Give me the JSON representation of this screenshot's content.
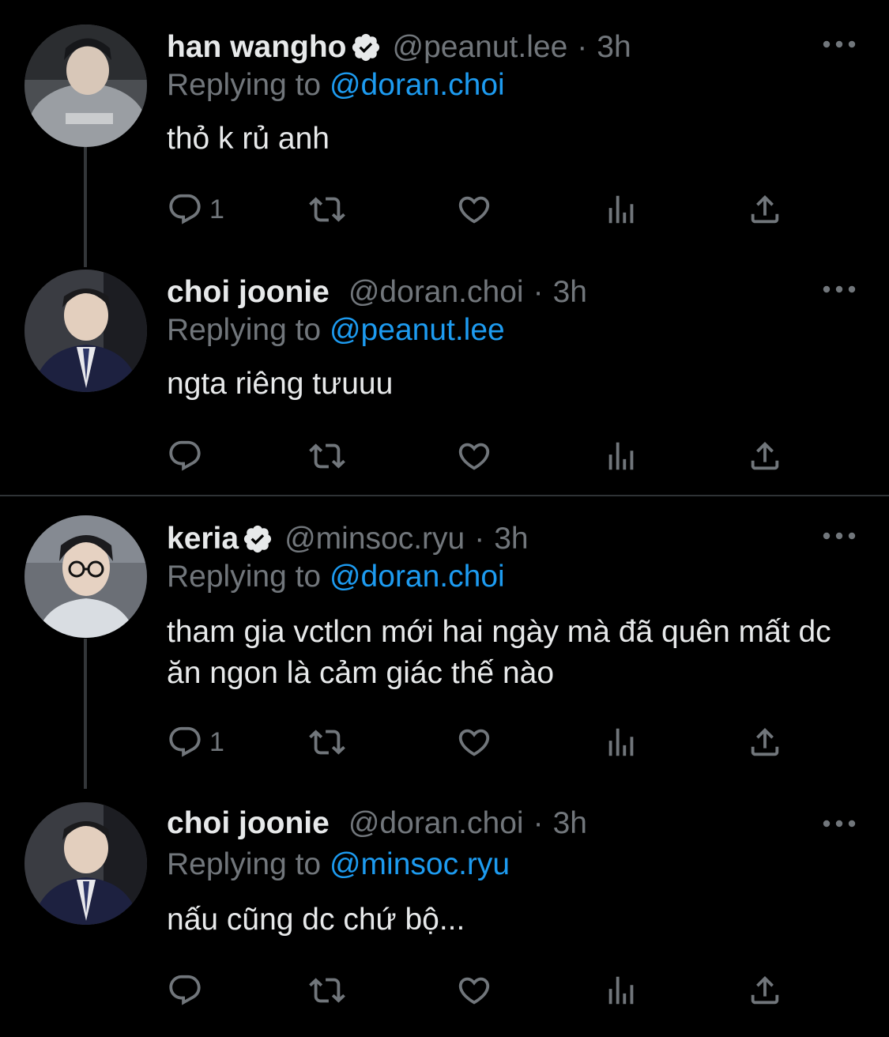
{
  "threads": [
    {
      "tweets": [
        {
          "display_name": "han wangho",
          "verified": true,
          "handle": "@peanut.lee",
          "separator": "·",
          "time": "3h",
          "replying_prefix": "Replying to",
          "replying_to": "@doran.choi",
          "body": "thỏ k rủ anh",
          "reply_count": "1"
        },
        {
          "display_name": "choi joonie",
          "verified": false,
          "handle": "@doran.choi",
          "separator": "·",
          "time": "3h",
          "replying_prefix": "Replying to",
          "replying_to": "@peanut.lee",
          "body": "ngta riêng tưuuu",
          "reply_count": ""
        }
      ]
    },
    {
      "tweets": [
        {
          "display_name": "keria",
          "verified": true,
          "handle": "@minsoc.ryu",
          "separator": "·",
          "time": "3h",
          "replying_prefix": "Replying to",
          "replying_to": "@doran.choi",
          "body": "tham gia vctlcn mới hai ngày mà đã quên mất dc ăn ngon là cảm giác thế nào",
          "reply_count": "1"
        },
        {
          "display_name": "choi joonie",
          "verified": false,
          "handle": "@doran.choi",
          "separator": "·",
          "time": "3h",
          "replying_prefix": "Replying to",
          "replying_to": "@minsoc.ryu",
          "body": "nấu cũng dc chứ bộ...",
          "reply_count": ""
        }
      ]
    }
  ],
  "icons": {
    "reply": "reply-icon",
    "retweet": "retweet-icon",
    "like": "heart-icon",
    "views": "views-icon",
    "share": "share-icon",
    "more": "more-icon",
    "verified": "verified-badge-icon"
  },
  "colors": {
    "background": "#000000",
    "primary_text": "#e7e9ea",
    "secondary_text": "#71767b",
    "mention": "#1d9bf0",
    "thread_line": "#333639",
    "divider": "#2f3336"
  }
}
